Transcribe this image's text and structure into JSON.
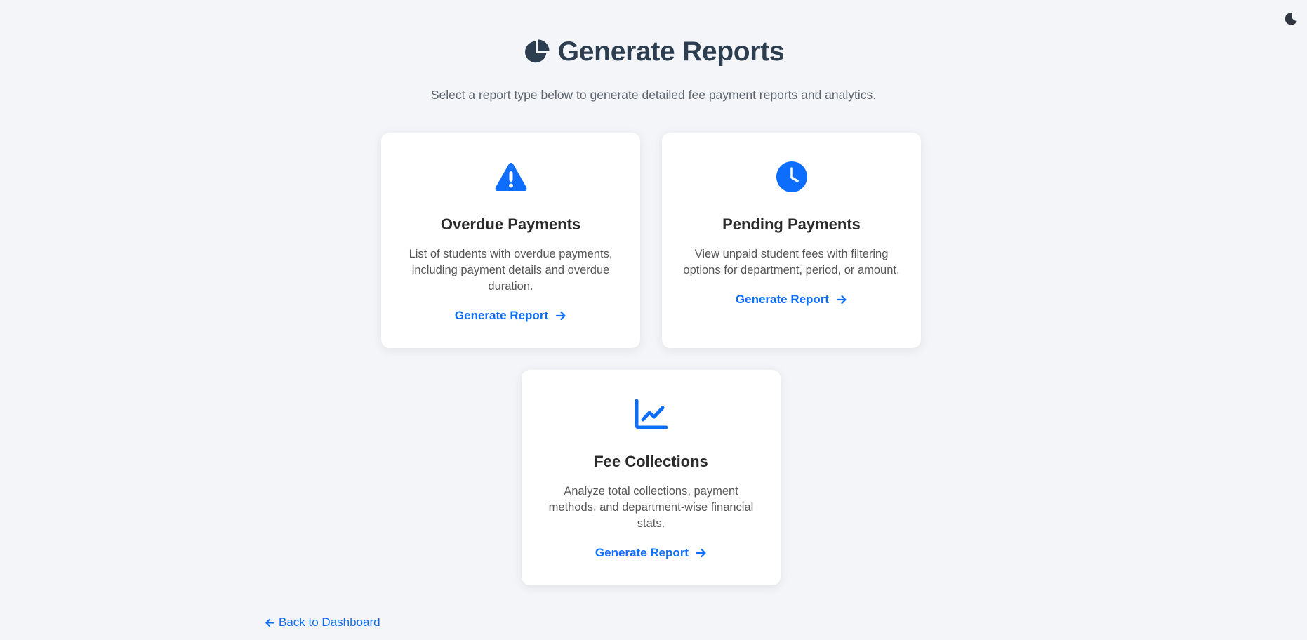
{
  "theme_toggle": {
    "icon": "moon-icon"
  },
  "header": {
    "title": "Generate Reports",
    "icon": "chart-pie-icon"
  },
  "subtitle": "Select a report type below to generate detailed fee payment reports and analytics.",
  "cards": [
    {
      "icon": "warning-triangle-icon",
      "title": "Overdue Payments",
      "description": "List of students with overdue payments, including payment details and overdue duration.",
      "link_label": "Generate Report"
    },
    {
      "icon": "clock-icon",
      "title": "Pending Payments",
      "description": "View unpaid student fees with filtering options for department, period, or amount.",
      "link_label": "Generate Report"
    },
    {
      "icon": "line-chart-icon",
      "title": "Fee Collections",
      "description": "Analyze total collections, payment methods, and department-wise financial stats.",
      "link_label": "Generate Report"
    }
  ],
  "back_link": {
    "label": "Back to Dashboard",
    "icon": "arrow-left-icon"
  },
  "colors": {
    "accent": "#0d6efd",
    "title": "#2c3e50",
    "background": "#f4f5f8"
  }
}
